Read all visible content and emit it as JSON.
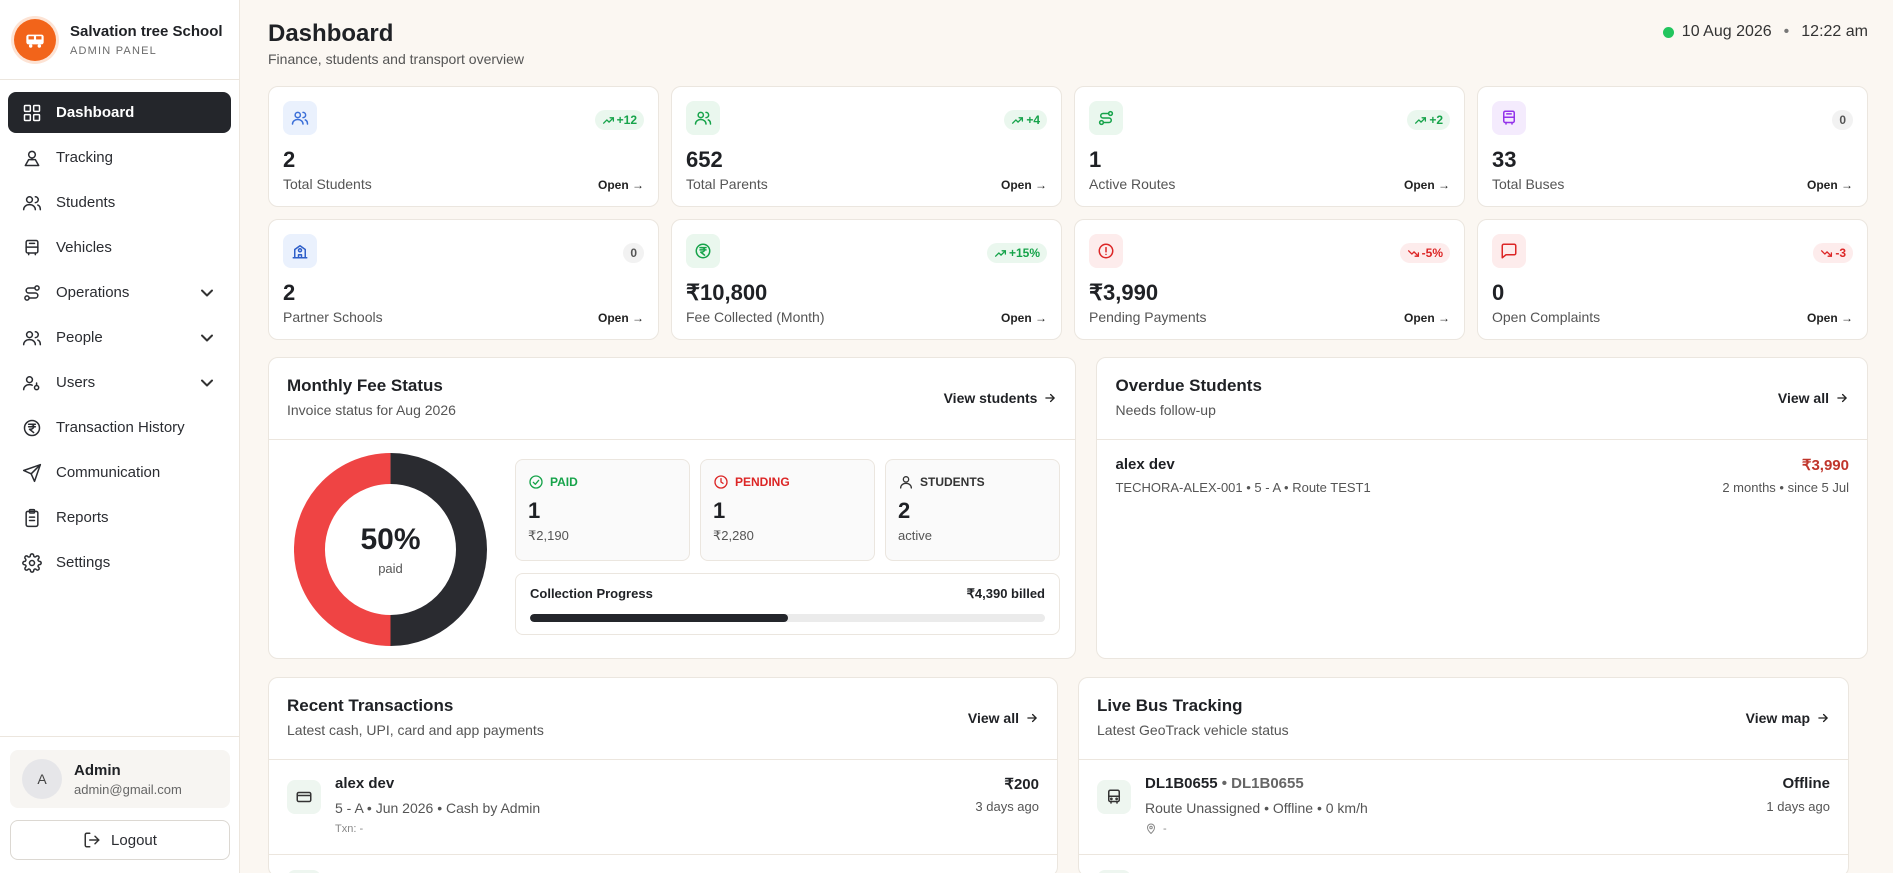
{
  "brand": {
    "name": "Salvation tree School",
    "subtitle": "ADMIN PANEL"
  },
  "sidebar": {
    "items": [
      {
        "label": "Dashboard",
        "icon": "dashboard-icon",
        "active": true
      },
      {
        "label": "Tracking",
        "icon": "tracking-icon"
      },
      {
        "label": "Students",
        "icon": "students-icon"
      },
      {
        "label": "Vehicles",
        "icon": "bus-icon"
      },
      {
        "label": "Operations",
        "icon": "route-icon",
        "expandable": true
      },
      {
        "label": "People",
        "icon": "people-icon",
        "expandable": true
      },
      {
        "label": "Users",
        "icon": "user-key-icon",
        "expandable": true
      },
      {
        "label": "Transaction History",
        "icon": "rupee-icon"
      },
      {
        "label": "Communication",
        "icon": "send-icon"
      },
      {
        "label": "Reports",
        "icon": "clipboard-icon"
      },
      {
        "label": "Settings",
        "icon": "gear-icon"
      }
    ]
  },
  "user": {
    "initial": "A",
    "name": "Admin",
    "email": "admin@gmail.com"
  },
  "logout_label": "Logout",
  "header": {
    "title": "Dashboard",
    "subtitle": "Finance, students and transport overview",
    "date": "10 Aug 2026",
    "separator": "•",
    "time": "12:22 am",
    "status_color": "#22c55e"
  },
  "stats": [
    {
      "value": "2",
      "label": "Total Students",
      "badge": "+12",
      "trend": "up",
      "open": "Open →",
      "icon": "users-icon",
      "accent": "#3b6fd8",
      "tint": "#eaf1fd"
    },
    {
      "value": "652",
      "label": "Total Parents",
      "badge": "+4",
      "trend": "up",
      "open": "Open →",
      "icon": "users-icon",
      "accent": "#16a34a",
      "tint": "#eaf7ee"
    },
    {
      "value": "1",
      "label": "Active Routes",
      "badge": "+2",
      "trend": "up",
      "open": "Open →",
      "icon": "route-icon",
      "accent": "#16a34a",
      "tint": "#eaf7ee"
    },
    {
      "value": "33",
      "label": "Total Buses",
      "badge": "0",
      "trend": "zero",
      "open": "Open →",
      "icon": "bus-icon",
      "accent": "#9333ea",
      "tint": "#f4ebfd"
    },
    {
      "value": "2",
      "label": "Partner Schools",
      "badge": "0",
      "trend": "zero",
      "open": "Open →",
      "icon": "school-icon",
      "accent": "#2f5fc9",
      "tint": "#eaf1fd"
    },
    {
      "value": "₹10,800",
      "label": "Fee Collected (Month)",
      "badge": "+15%",
      "trend": "up",
      "open": "Open →",
      "icon": "rupee-icon",
      "accent": "#16a34a",
      "tint": "#eaf7ee"
    },
    {
      "value": "₹3,990",
      "label": "Pending Payments",
      "badge": "-5%",
      "trend": "down",
      "open": "Open →",
      "icon": "alert-icon",
      "accent": "#dc2626",
      "tint": "#fdecec"
    },
    {
      "value": "0",
      "label": "Open Complaints",
      "badge": "-3",
      "trend": "down",
      "open": "Open →",
      "icon": "message-icon",
      "accent": "#dc2626",
      "tint": "#fdecec"
    }
  ],
  "fee": {
    "title": "Monthly Fee Status",
    "subtitle": "Invoice status for Aug 2026",
    "link": "View students",
    "percent": "50%",
    "percent_sub": "paid",
    "paid_fraction": 0.5,
    "paid_color": "#2a2b30",
    "pending_color": "#ef4444",
    "cards": [
      {
        "head": "PAID",
        "value": "1",
        "sub": "₹2,190",
        "icon": "check-circle-icon",
        "color": "#16a34a"
      },
      {
        "head": "PENDING",
        "value": "1",
        "sub": "₹2,280",
        "icon": "clock-icon",
        "color": "#dc2626"
      },
      {
        "head": "STUDENTS",
        "value": "2",
        "sub": "active",
        "icon": "user-icon",
        "color": "#333333"
      }
    ],
    "progress_label": "Collection Progress",
    "progress_total": "₹4,390 billed",
    "progress_fraction": 0.5
  },
  "overdue": {
    "title": "Overdue Students",
    "subtitle": "Needs follow-up",
    "link": "View all",
    "rows": [
      {
        "name": "alex dev",
        "meta": "TECHORA-ALEX-001 • 5 - A • Route TEST1",
        "amount": "₹3,990",
        "when": "2 months • since 5 Jul"
      }
    ]
  },
  "transactions": {
    "title": "Recent Transactions",
    "subtitle": "Latest cash, UPI, card and app payments",
    "link": "View all",
    "rows": [
      {
        "name": "alex dev",
        "meta": "5 - A • Jun 2026 • Cash by Admin",
        "txn": "Txn: -",
        "amount": "₹200",
        "when": "3 days ago"
      }
    ]
  },
  "live": {
    "title": "Live Bus Tracking",
    "subtitle": "Latest GeoTrack vehicle status",
    "link": "View map",
    "rows": [
      {
        "plate": "DL1B0655",
        "sep": "•",
        "alias": "DL1B0655",
        "meta": "Route Unassigned • Offline • 0 km/h",
        "location": "-",
        "status": "Offline",
        "when": "1 days ago"
      }
    ]
  }
}
